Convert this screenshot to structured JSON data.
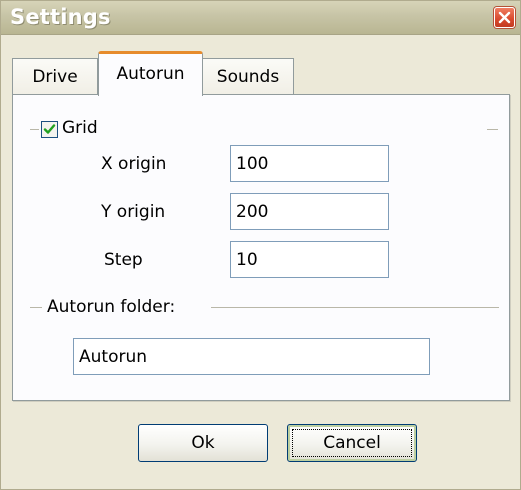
{
  "window": {
    "title": "Settings",
    "close_icon": "close-icon"
  },
  "tabs": [
    {
      "label": "Drive",
      "selected": false
    },
    {
      "label": "Autorun",
      "selected": true
    },
    {
      "label": "Sounds",
      "selected": false
    }
  ],
  "grid": {
    "checkbox_label": "Grid",
    "checked": true,
    "x_origin_label": "X origin",
    "x_origin_value": "100",
    "y_origin_label": "Y origin",
    "y_origin_value": "200",
    "step_label": "Step",
    "step_value": "10"
  },
  "autorun": {
    "folder_label": "Autorun folder:",
    "folder_value": "Autorun"
  },
  "buttons": {
    "ok_label": "Ok",
    "cancel_label": "Cancel"
  },
  "colors": {
    "accent_tab": "#e68b2c",
    "checkmark": "#21a121",
    "close_button": "#d8492d",
    "focus_border": "#bccfa0"
  }
}
